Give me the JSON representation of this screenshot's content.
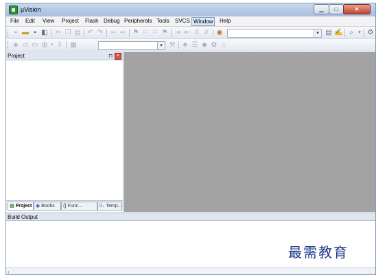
{
  "window": {
    "title": "µVision"
  },
  "menu": [
    "File",
    "Edit",
    "View",
    "Project",
    "Flash",
    "Debug",
    "Peripherals",
    "Tools",
    "SVCS",
    "Window",
    "Help"
  ],
  "project_panel": {
    "title": "Project",
    "pin": "⊓",
    "close": "×",
    "tabs": [
      "Project",
      "Books",
      "Func...",
      "Temp..."
    ]
  },
  "build_output": {
    "title": "Build Output"
  },
  "watermark": "最需教育",
  "colors": {
    "editor_bg": "#a3a3a3",
    "title_bar": "#b7cbe6",
    "close_button": "#c0432c"
  }
}
